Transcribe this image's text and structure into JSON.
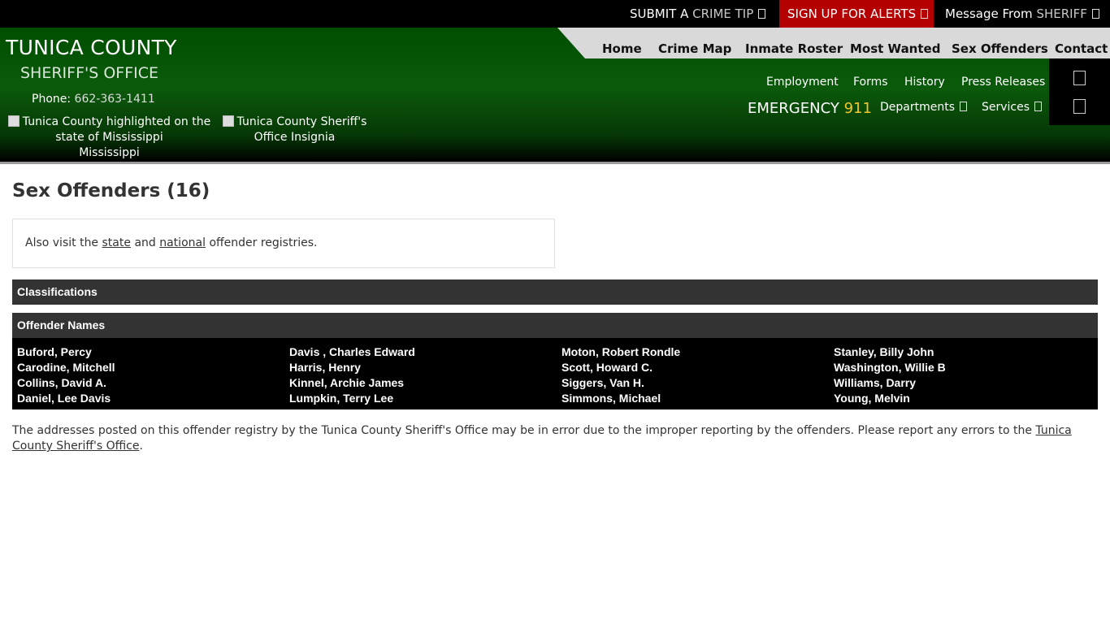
{
  "topbar": {
    "tip_a": "SUBMIT A",
    "tip_b": "CRIME TIP",
    "alerts_a": "SIGN UP FOR ALERTS",
    "msg_a": "Message From",
    "msg_b": "SHERIFF",
    "alert_bg": "#b40000"
  },
  "header": {
    "title": "TUNICA COUNTY",
    "subtitle": "SHERIFF'S OFFICE",
    "phone_label": "Phone:",
    "phone_number": "662-363-1411",
    "img_state_alt": "Tunica County highlighted on the state of Mississippi",
    "img_state_caption": "Mississippi",
    "img_insignia_alt": "Tunica County Sheriff's Office Insignia"
  },
  "nav": {
    "home": "Home",
    "crime_map": "Crime Map",
    "inmate_roster": "Inmate Roster",
    "most_wanted": "Most Wanted",
    "sex_offenders": "Sex Offenders",
    "contact": "Contact"
  },
  "subnav": {
    "employment": "Employment",
    "forms": "Forms",
    "history": "History",
    "press_releases": "Press Releases",
    "departments": "Departments",
    "services": "Services"
  },
  "emergency": {
    "label": "EMERGENCY",
    "number": "911",
    "number_color": "#f3c62b"
  },
  "main": {
    "title": "Sex Offenders (16)",
    "visit_pre": "Also visit the",
    "visit_state": "state",
    "visit_and": "and",
    "visit_national": "national",
    "visit_post": "offender registries.",
    "classifications_label": "Classifications",
    "offender_names_label": "Offender Names",
    "names": [
      [
        "Buford, Percy",
        "Carodine, Mitchell",
        "Collins, David A.",
        "Daniel, Lee Davis"
      ],
      [
        "Davis , Charles Edward",
        "Harris, Henry",
        "Kinnel, Archie James",
        "Lumpkin, Terry Lee"
      ],
      [
        "Moton, Robert Rondle",
        "Scott, Howard C.",
        "Siggers, Van H.",
        "Simmons, Michael"
      ],
      [
        "Stanley, Billy John",
        "Washington, Willie B",
        "Williams, Darry",
        "Young, Melvin"
      ]
    ],
    "disclaimer": "The addresses posted on this offender registry by the Tunica County Sheriff's Office may be in error due to the improper reporting by the offenders. Please report any errors to the",
    "disclaimer_link": "Tunica County Sheriff's Office",
    "disclaimer_end": "."
  }
}
